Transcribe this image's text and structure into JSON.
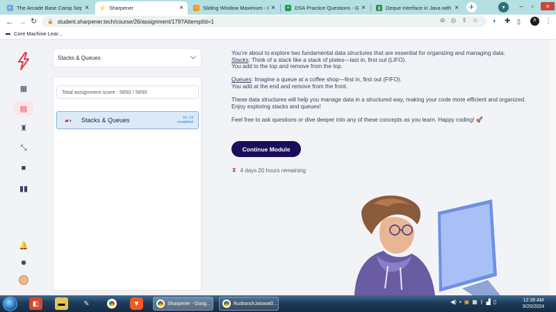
{
  "browser": {
    "tabs": [
      {
        "title": "The Arcade Base Camp Septe",
        "active": false
      },
      {
        "title": "Sharpener",
        "active": true
      },
      {
        "title": "Sliding Window Maximum - Le",
        "active": false
      },
      {
        "title": "DSA Practice Questions - Goo",
        "active": false
      },
      {
        "title": "Deque interface in Java with E",
        "active": false
      }
    ],
    "url": "student.sharpener.tech/course/26/assignment/179?AttemptId=1",
    "profile_initial": "R",
    "bookmark": "Core Machine Lear..."
  },
  "sidebar": {
    "icons": [
      "dashboard-icon",
      "assignment-icon",
      "trophy-icon",
      "expand-icon",
      "video-icon",
      "chart-icon",
      "bell-icon",
      "bug-icon"
    ],
    "active_index": 1,
    "accent": "#e53948"
  },
  "course": {
    "dropdown_value": "Stacks & Queues",
    "score_text": "Total assignment score : 5650 / 5650",
    "module": {
      "label": "Stacks & Queues",
      "progress": "19 / 19",
      "status": "completed"
    }
  },
  "content": {
    "intro": "You’re about to explore two fundamental data structures that are essential for organizing and managing data:",
    "stacks_term": "Stacks",
    "stacks_desc": ": Think of a stack like a stack of plates—last in, first out (LIFO).",
    "stacks_line2": "You add to the top and remove from the top.",
    "queues_term": "Queues",
    "queues_desc": ": Imagine a queue at a coffee shop—first in, first out (FIFO).",
    "queues_line2": "You add at the end and remove from the front.",
    "para3": "These data structures will help you manage data in a structured way, making your code more efficient and organized. Enjoy exploring stacks and queues!",
    "para4": "Feel free to ask questions or dive deeper into any of these concepts as you learn. Happy coding! 🚀",
    "button": "Continue Module",
    "remaining": "4 days 20 hours remaining"
  },
  "taskbar": {
    "tasks": [
      "Sharpener - Goog...",
      "RudranshJaiswal0..."
    ],
    "time": "12:39 AM",
    "date": "9/20/2024"
  }
}
